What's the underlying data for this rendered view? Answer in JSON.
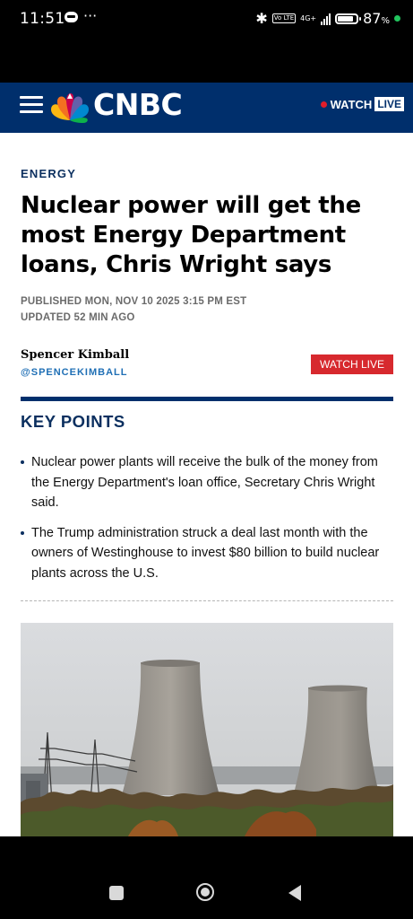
{
  "status_bar": {
    "time": "11:51",
    "more": "···",
    "lte": "Vo LTE",
    "network": "4G+",
    "battery": "87",
    "battery_unit": "%"
  },
  "header": {
    "logo": "CNBC",
    "watch_label": "WATCH",
    "live_label": "LIVE"
  },
  "article": {
    "section": "ENERGY",
    "headline": "Nuclear power will get the most Energy Department loans, Chris Wright says",
    "published": "PUBLISHED MON, NOV 10 2025 3:15 PM EST",
    "updated": "UPDATED 52 MIN AGO",
    "author": "Spencer Kimball",
    "handle": "@SPENCEKIMBALL",
    "watch_live_button": "WATCH LIVE",
    "key_points_title": "KEY POINTS",
    "key_points": [
      "Nuclear power plants will receive the bulk of the money from the Energy Department's loan office, Secretary Chris Wright said.",
      "The Trump administration struck a deal last month with the owners of Westinghouse to invest $80 billion to build nuclear plants across the U.S."
    ]
  },
  "colors": {
    "brand_navy": "#002f6c",
    "section_blue": "#0b2f5f",
    "live_red": "#d7292e",
    "handle_blue": "#1f6fb5"
  },
  "icons": {
    "menu": "hamburger-menu-icon",
    "logo": "nbc-peacock-icon",
    "nav_recents": "square-icon",
    "nav_home": "circle-icon",
    "nav_back": "triangle-back-icon"
  }
}
